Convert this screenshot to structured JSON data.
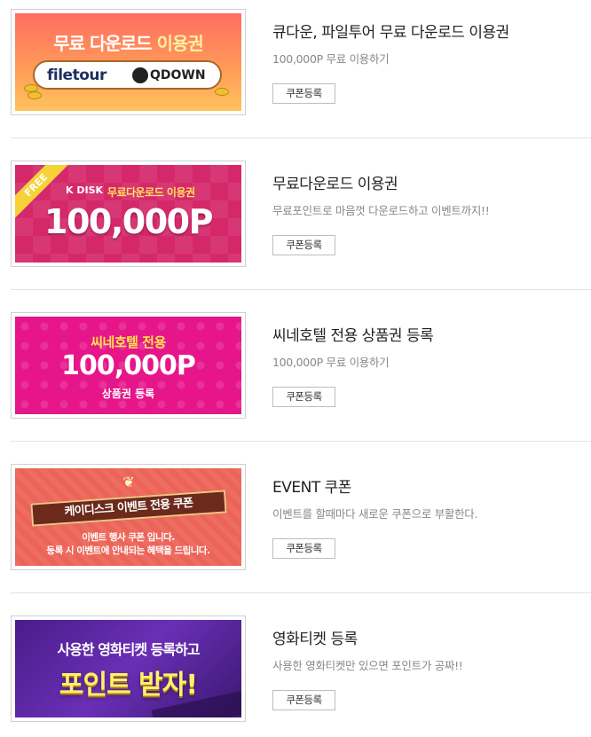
{
  "items": [
    {
      "title": "큐다운, 파일투어 무료 다운로드 이용권",
      "desc": "100,000P 무료 이용하기",
      "button": "쿠폰등록",
      "banner": {
        "head_a": "무료 다운로드",
        "head_b": "이용권",
        "logo_a": "filetour",
        "logo_b": "QDOWN",
        "bg": "#ff8a5c"
      }
    },
    {
      "title": "무료다운로드 이용권",
      "desc": "무료포인트로 마음껏 다운로드하고 이벤트까지!!",
      "button": "쿠폰등록",
      "banner": {
        "ribbon": "FREE",
        "brand": "K DISK",
        "sub": "무료다운로드 이용권",
        "big": "100,000P",
        "bg": "#d5286b"
      }
    },
    {
      "title": "씨네호텔 전용 상품권 등록",
      "desc": "100,000P 무료 이용하기",
      "button": "쿠폰등록",
      "banner": {
        "top": "씨네호텔 전용",
        "big": "100,000P",
        "bottom": "상품권 등록",
        "bg": "#e6158a"
      }
    },
    {
      "title": "EVENT 쿠폰",
      "desc": "이벤트를 할때마다 새로운 쿠폰으로 부활한다.",
      "button": "쿠폰등록",
      "banner": {
        "ribbon": "케이디스크 이벤트 전용 쿠폰",
        "line1": "이벤트 행사 쿠폰 입니다.",
        "line2": "등록 시 이벤트에 안내되는 혜택을 드립니다.",
        "bg": "#ec6458"
      }
    },
    {
      "title": "영화티켓 등록",
      "desc": "사용한 영화티켓만 있으면 포인트가 공짜!!",
      "button": "쿠폰등록",
      "banner": {
        "line1": "사용한 영화티켓 등록하고",
        "line2": "포인트 받자!",
        "bg": "#5a27a0"
      }
    }
  ]
}
